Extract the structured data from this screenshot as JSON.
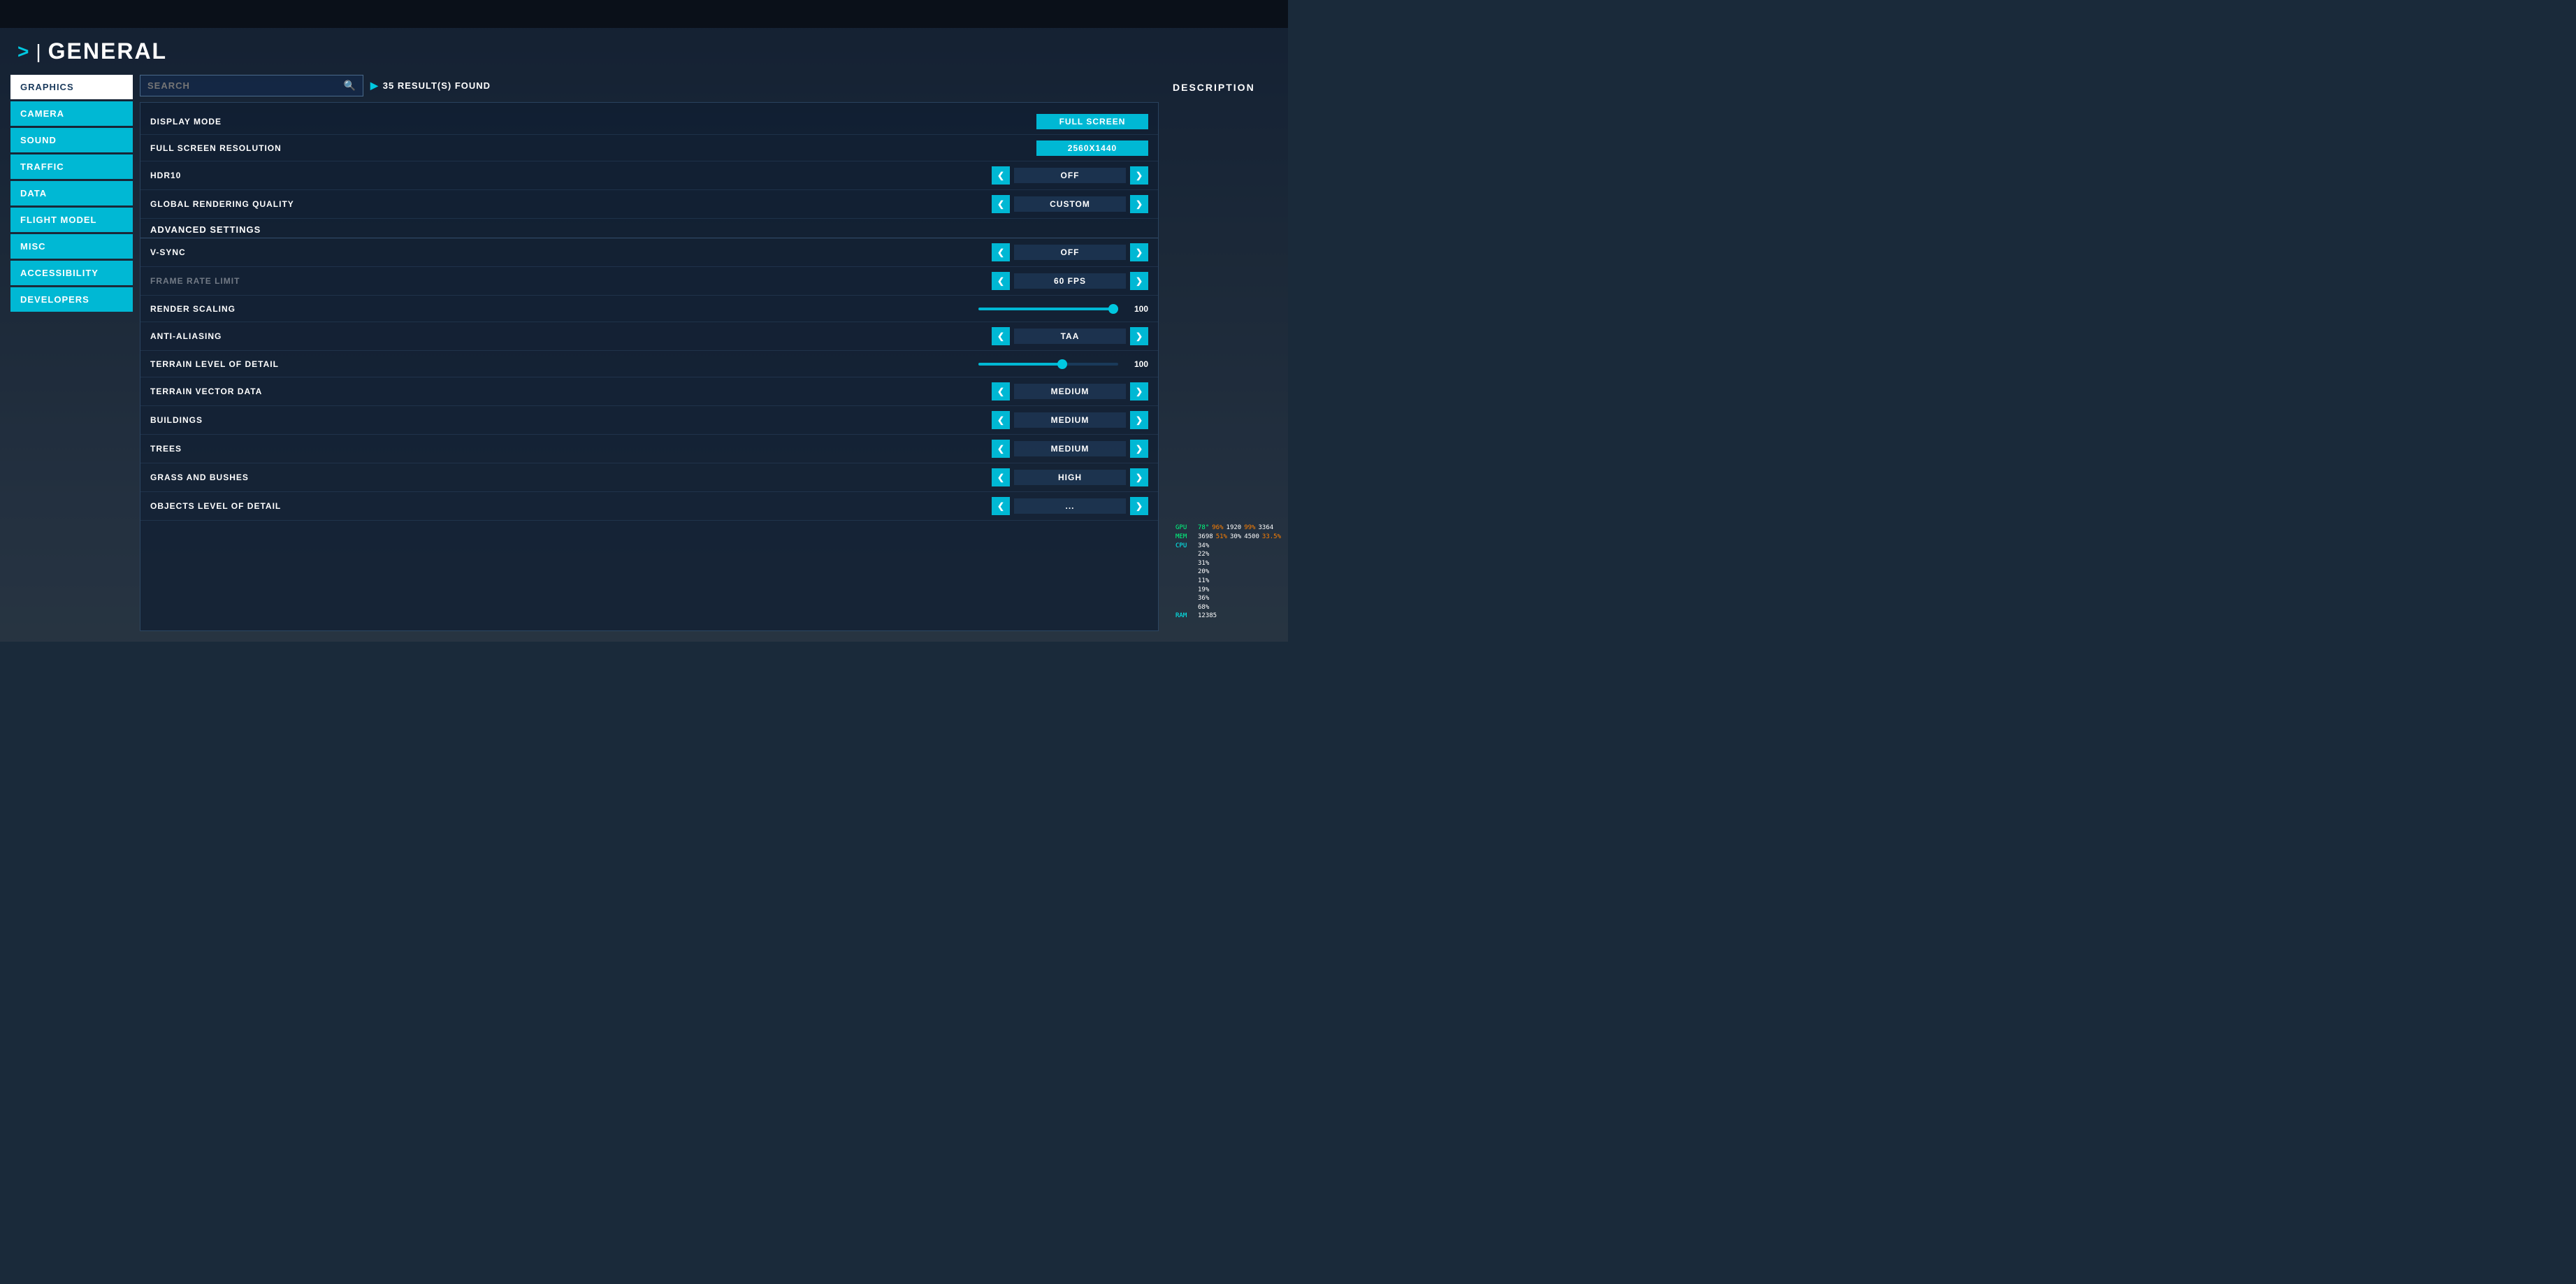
{
  "header": {
    "arrow": ">",
    "divider": "|",
    "title": "GENERAL"
  },
  "sidebar": {
    "items": [
      {
        "id": "graphics",
        "label": "GRAPHICS",
        "state": "active"
      },
      {
        "id": "camera",
        "label": "CAMERA",
        "state": "highlighted"
      },
      {
        "id": "sound",
        "label": "SOUND",
        "state": "highlighted"
      },
      {
        "id": "traffic",
        "label": "TRAFFIC",
        "state": "highlighted"
      },
      {
        "id": "data",
        "label": "DATA",
        "state": "highlighted"
      },
      {
        "id": "flight-model",
        "label": "FLIGHT MODEL",
        "state": "highlighted"
      },
      {
        "id": "misc",
        "label": "MISC",
        "state": "highlighted"
      },
      {
        "id": "accessibility",
        "label": "ACCESSIBILITY",
        "state": "highlighted"
      },
      {
        "id": "developers",
        "label": "DEVELOPERS",
        "state": "highlighted"
      }
    ]
  },
  "search": {
    "placeholder": "SEARCH",
    "results_label": "35 RESULT(S) FOUND"
  },
  "settings": {
    "advanced_section": "ADVANCED SETTINGS",
    "rows": [
      {
        "id": "display-mode",
        "label": "DISPLAY MODE",
        "control_type": "value",
        "value": "FULL SCREEN",
        "cyan_bg": true
      },
      {
        "id": "fullscreen-res",
        "label": "FULL SCREEN RESOLUTION",
        "control_type": "value",
        "value": "2560X1440",
        "cyan_bg": true
      },
      {
        "id": "hdr10",
        "label": "HDR10",
        "control_type": "arrow",
        "value": "OFF"
      },
      {
        "id": "global-rendering",
        "label": "GLOBAL RENDERING QUALITY",
        "control_type": "arrow",
        "value": "CUSTOM"
      },
      {
        "id": "vsync",
        "label": "V-SYNC",
        "control_type": "arrow",
        "value": "OFF"
      },
      {
        "id": "frame-rate",
        "label": "FRAME RATE LIMIT",
        "control_type": "arrow",
        "value": "60 FPS",
        "dimmed": true
      },
      {
        "id": "render-scaling",
        "label": "RENDER SCALING",
        "control_type": "slider",
        "value": 100,
        "slider_pct": 100
      },
      {
        "id": "anti-aliasing",
        "label": "ANTI-ALIASING",
        "control_type": "arrow",
        "value": "TAA"
      },
      {
        "id": "terrain-lod",
        "label": "TERRAIN LEVEL OF DETAIL",
        "control_type": "slider",
        "value": 100,
        "slider_pct": 60
      },
      {
        "id": "terrain-vector",
        "label": "TERRAIN VECTOR DATA",
        "control_type": "arrow",
        "value": "MEDIUM"
      },
      {
        "id": "buildings",
        "label": "BUILDINGS",
        "control_type": "arrow",
        "value": "MEDIUM"
      },
      {
        "id": "trees",
        "label": "TREES",
        "control_type": "arrow",
        "value": "MEDIUM"
      },
      {
        "id": "grass",
        "label": "GRASS AND BUSHES",
        "control_type": "arrow",
        "value": "HIGH"
      },
      {
        "id": "objects-lod",
        "label": "OBJECTS LEVEL OF DETAIL",
        "control_type": "arrow",
        "value": "..."
      }
    ]
  },
  "description": {
    "title": "DESCRIPTION"
  },
  "perf": {
    "gpu_label": "GPU",
    "gpu_val1": "78°",
    "gpu_val2": "96%",
    "gpu_val3": "1920",
    "gpu_val4": "99%",
    "gpu_val5": "3364",
    "mem_label": "MEM",
    "mem_val": "3698",
    "cpu_label": "CPU",
    "cpu_val1": "51%",
    "cpu_val2": "30%",
    "cpu_val3": "4500",
    "cpu_val4": "33.5%",
    "cpu0": "34%",
    "cpu1": "22%",
    "cpu2": "31%",
    "cpu3": "20%",
    "cpu4": "11%",
    "cpu5": "19%",
    "cpu6": "36%",
    "cpu7": "68%",
    "ram_label": "RAM",
    "ram_val": "12385"
  }
}
